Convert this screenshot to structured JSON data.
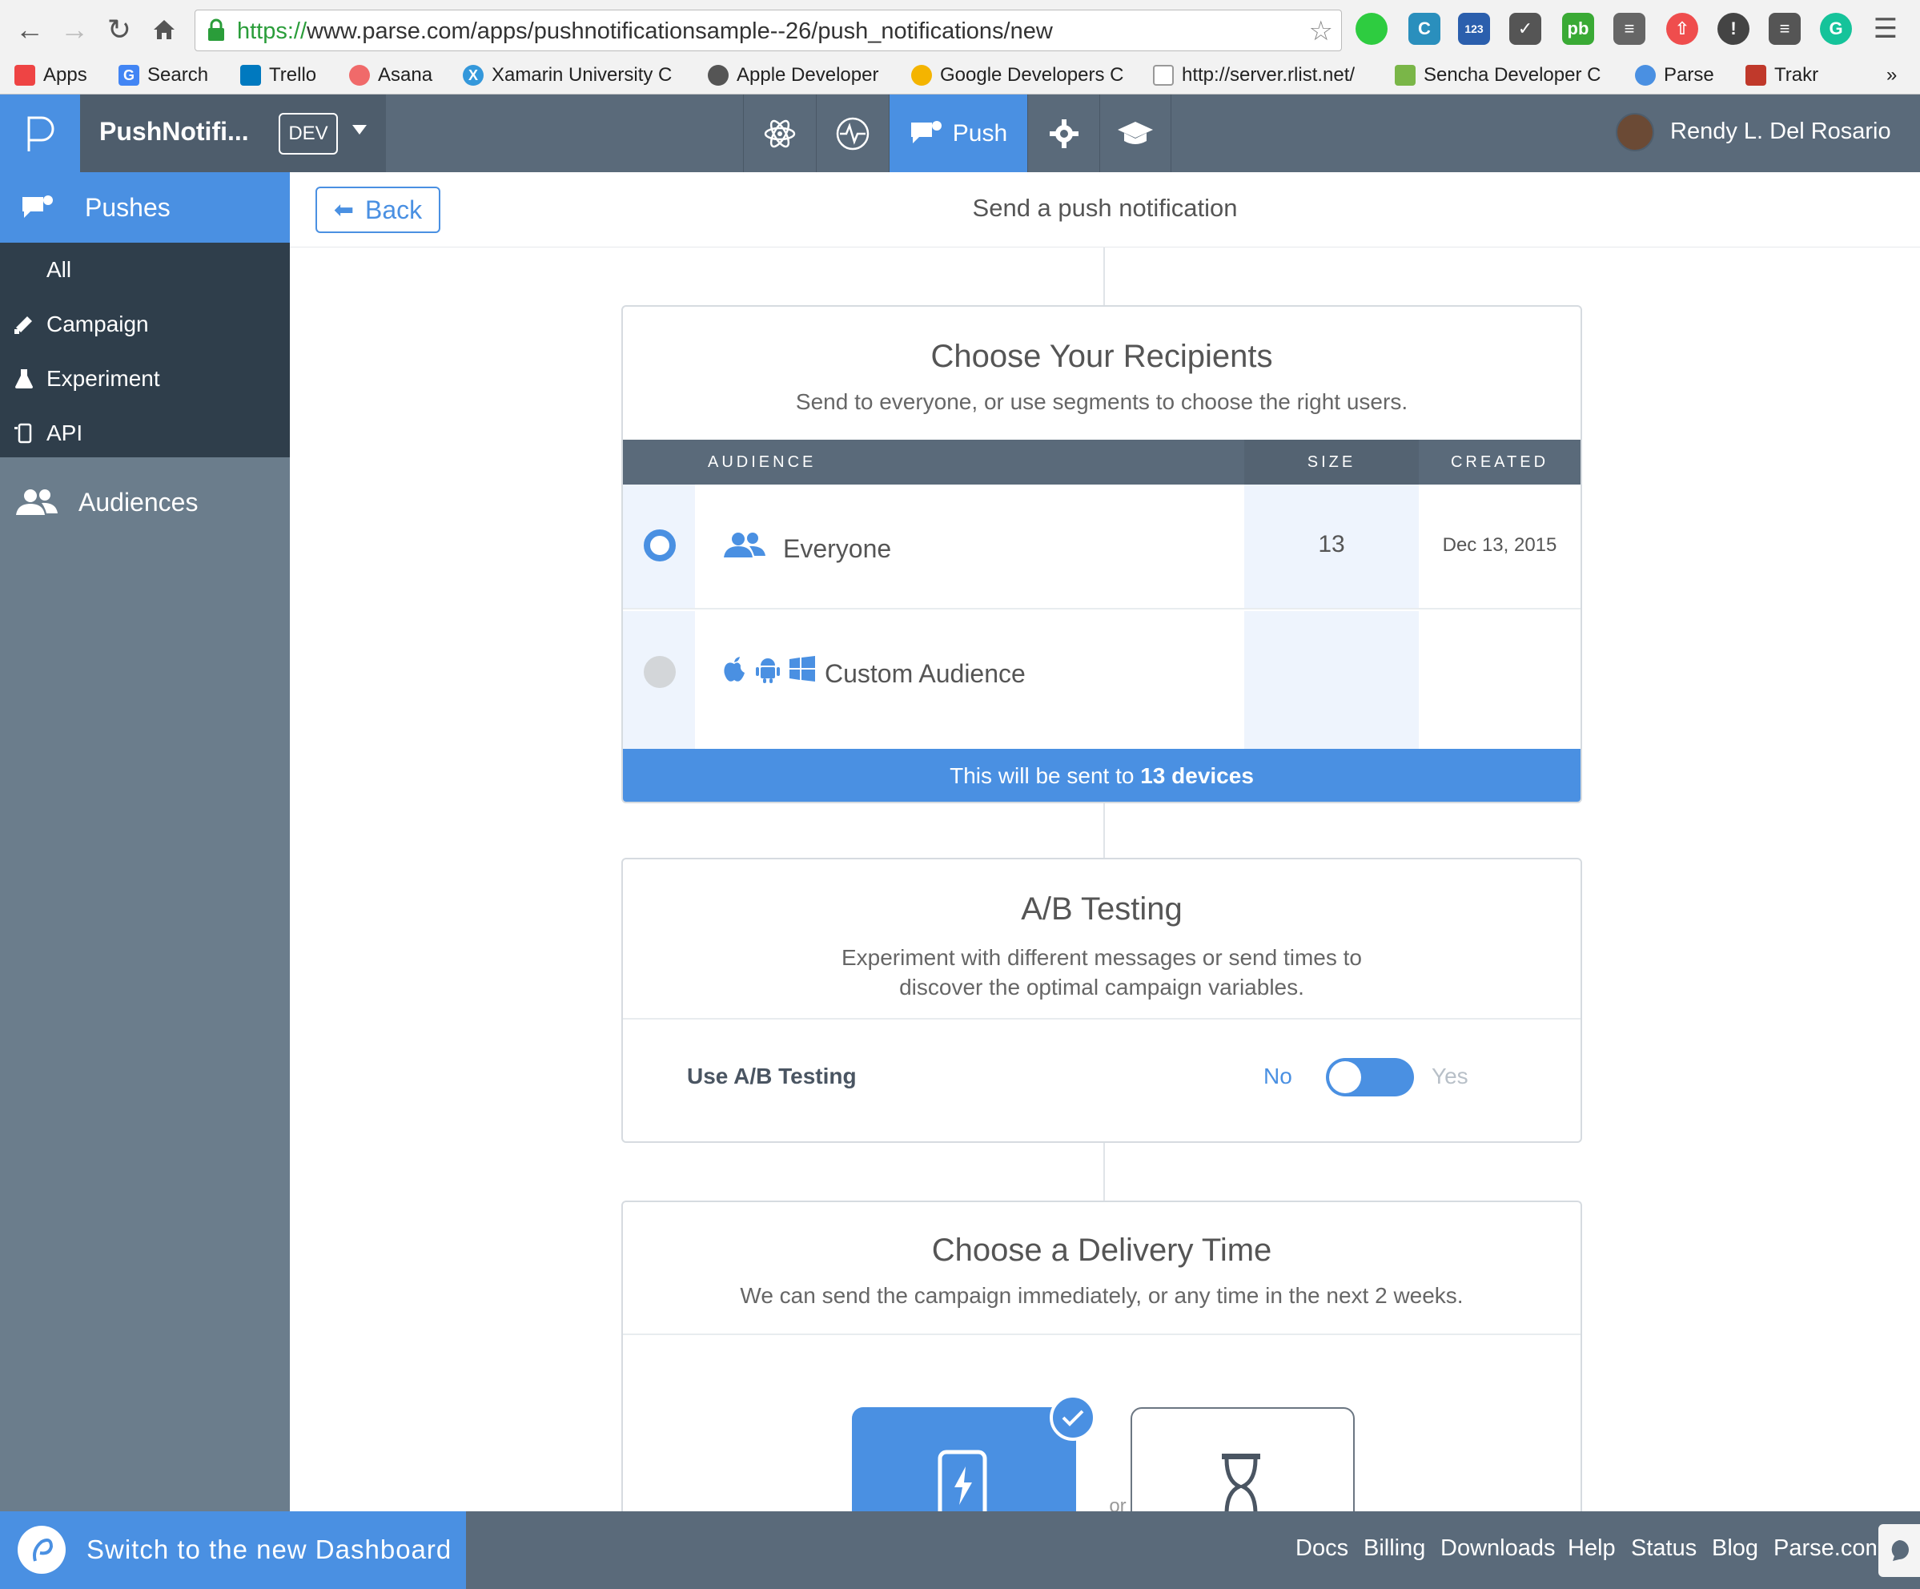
{
  "browser": {
    "url_scheme": "https://",
    "url_rest": "www.parse.com/apps/pushnotificationsample--26/push_notifications/new",
    "bookmarks": [
      {
        "label": "Apps",
        "icon": "apps-grid-icon",
        "color": "#e44"
      },
      {
        "label": "Search",
        "icon": "google-icon",
        "color": "#4285f4"
      },
      {
        "label": "Trello",
        "icon": "trello-icon",
        "color": "#0079bf"
      },
      {
        "label": "Asana",
        "icon": "asana-icon",
        "color": "#f06a6a"
      },
      {
        "label": "Xamarin University C",
        "icon": "xamarin-icon",
        "color": "#3498db"
      },
      {
        "label": "Apple Developer",
        "icon": "apple-icon",
        "color": "#555"
      },
      {
        "label": "Google Developers C",
        "icon": "google-developers-icon",
        "color": "#f4b400"
      },
      {
        "label": "http://server.rlist.net/",
        "icon": "page-icon",
        "color": "#999"
      },
      {
        "label": "Sencha Developer C",
        "icon": "sencha-icon",
        "color": "#7ab648"
      },
      {
        "label": "Parse",
        "icon": "parse-icon",
        "color": "#4a90e2"
      },
      {
        "label": "Trakr",
        "icon": "trakr-icon",
        "color": "#c0392b"
      }
    ],
    "bookmarks_overflow": "»"
  },
  "app": {
    "name": "PushNotifi...",
    "env_badge": "DEV",
    "active_nav": "Push",
    "user_name": "Rendy L. Del Rosario"
  },
  "sidebar": {
    "pushes": "Pushes",
    "sub_items": [
      {
        "label": "All",
        "icon": ""
      },
      {
        "label": "Campaign",
        "icon": "megaphone-icon"
      },
      {
        "label": "Experiment",
        "icon": "flask-icon"
      },
      {
        "label": "API",
        "icon": "device-icon"
      }
    ],
    "audiences": "Audiences"
  },
  "header": {
    "back": "Back",
    "title": "Send a push notification"
  },
  "recipients": {
    "title": "Choose Your Recipients",
    "subtitle": "Send to everyone, or use segments to choose the right users.",
    "columns": {
      "audience": "AUDIENCE",
      "size": "SIZE",
      "created": "CREATED"
    },
    "rows": [
      {
        "name": "Everyone",
        "size": "13",
        "created": "Dec 13, 2015",
        "selected": true
      },
      {
        "name": "Custom Audience",
        "size": "",
        "created": "",
        "selected": false
      }
    ],
    "footer_prefix": "This will be sent to ",
    "footer_count": "13 devices"
  },
  "ab_testing": {
    "title": "A/B Testing",
    "subtitle_line1": "Experiment with different messages or send times to",
    "subtitle_line2": "discover the optimal campaign variables.",
    "label": "Use A/B Testing",
    "no": "No",
    "yes": "Yes"
  },
  "delivery": {
    "title": "Choose a Delivery Time",
    "subtitle": "We can send the campaign immediately, or any time in the next 2 weeks.",
    "or_label": "or"
  },
  "footer": {
    "switch": "Switch to the new Dashboard",
    "links": [
      "Docs",
      "Billing",
      "Downloads",
      "Help",
      "Status",
      "Blog",
      "Parse.com"
    ]
  },
  "colors": {
    "accent": "#4a90e2",
    "header": "#5a6a7a",
    "sidebar": "#6b7d8c",
    "sidebar_dark": "#2f3e4b"
  }
}
